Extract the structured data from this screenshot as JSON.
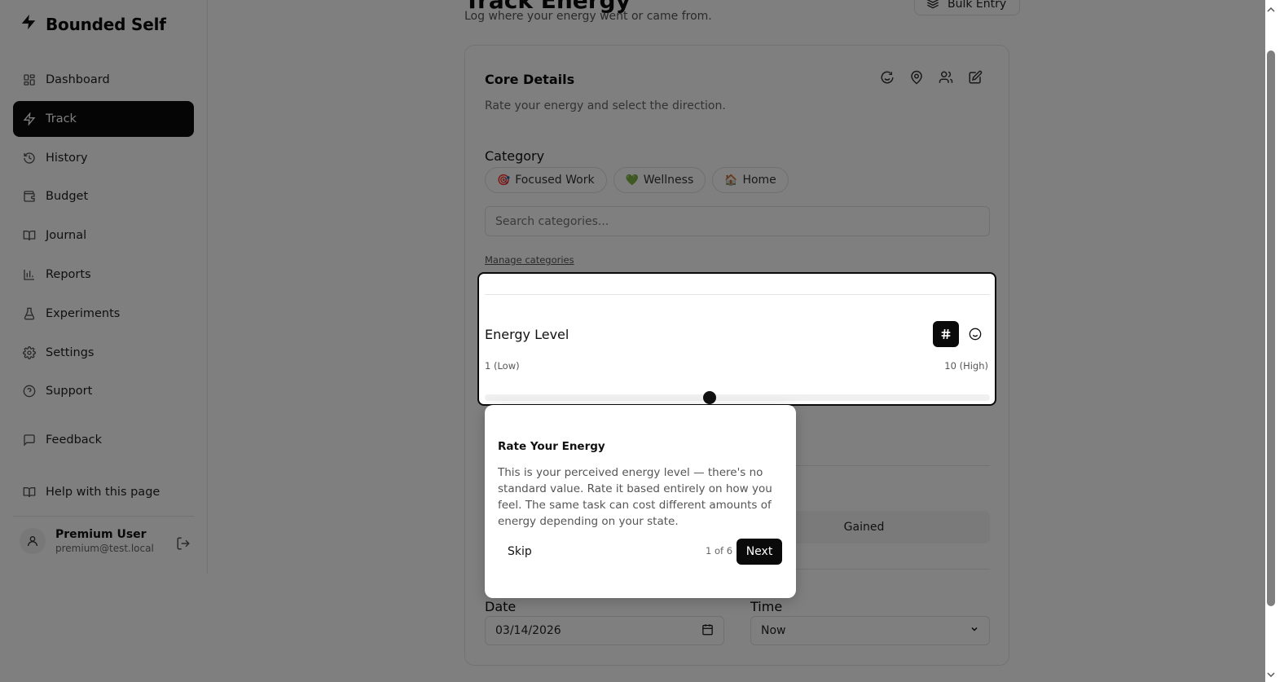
{
  "app": {
    "name": "Bounded Self"
  },
  "sidebar": {
    "items": [
      {
        "label": "Dashboard",
        "icon": "grid-icon"
      },
      {
        "label": "Track",
        "icon": "zap-icon",
        "active": true
      },
      {
        "label": "History",
        "icon": "history-icon"
      },
      {
        "label": "Budget",
        "icon": "wallet-icon"
      },
      {
        "label": "Journal",
        "icon": "book-icon"
      },
      {
        "label": "Reports",
        "icon": "bar-chart-icon"
      },
      {
        "label": "Experiments",
        "icon": "flask-icon"
      },
      {
        "label": "Settings",
        "icon": "gear-icon"
      },
      {
        "label": "Support",
        "icon": "help-circle-icon"
      }
    ],
    "feedback": "Feedback",
    "help": "Help with this page",
    "user": {
      "name": "Premium User",
      "email": "premium@test.local"
    }
  },
  "header": {
    "title": "Track Energy",
    "subtitle": "Log where your energy went or came from.",
    "bulk_entry": "Bulk Entry"
  },
  "card": {
    "title": "Core Details",
    "description": "Rate your energy and select the direction.",
    "category_label": "Category",
    "chips": [
      {
        "emoji": "🎯",
        "label": "Focused Work"
      },
      {
        "emoji": "💚",
        "label": "Wellness"
      },
      {
        "emoji": "🏠",
        "label": "Home"
      }
    ],
    "search_placeholder": "Search categories...",
    "manage_link": "Manage categories",
    "energy": {
      "title": "Energy Level",
      "low": "1 (Low)",
      "high": "10 (High)",
      "value_fraction": 0.445
    },
    "direction_gained": "Gained",
    "date_label": "Date",
    "date_value": "03/14/2026",
    "time_label": "Time",
    "time_value": "Now"
  },
  "tour": {
    "title": "Rate Your Energy",
    "body": "This is your perceived energy level — there's no standard value. Rate it based entirely on how you feel. The same task can cost different amounts of energy depending on your state.",
    "skip": "Skip",
    "count": "1 of 6",
    "next": "Next"
  },
  "colors": {
    "accent": "#0a0a0a",
    "overlay": "rgba(0,0,0,0.5)"
  }
}
